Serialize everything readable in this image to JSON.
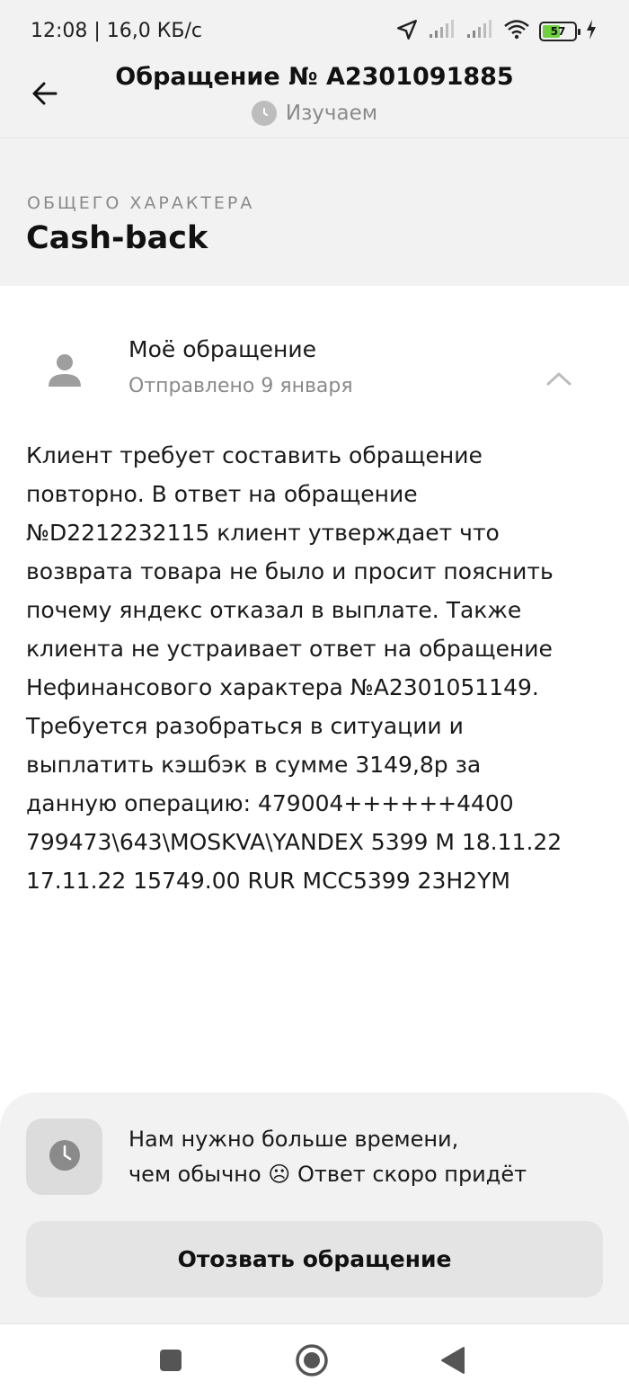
{
  "status_bar": {
    "time_speed": "12:08 | 16,0 КБ/с",
    "battery_level": "57",
    "battery_fraction": 0.57
  },
  "header": {
    "title": "Обращение № A2301091885",
    "status": "Изучаем"
  },
  "category": {
    "label": "ОБЩЕГО ХАРАКТЕРА",
    "title": "Cash-back"
  },
  "message": {
    "title": "Моё обращение",
    "date": "Отправлено 9 января",
    "body": "Клиент требует составить обращение\nповторно. В ответ на обращение\n№D2212232115 клиент утверждает что\nвозврата товара не было и просит пояснить\nпочему яндекс отказал в выплате. Также\nклиента не устраивает ответ на обращение\nНефинансового характера №A2301051149.\nТребуется разобраться в ситуации и\nвыплатить кэшбэк в сумме 3149,8р за\nданную операцию: 479004++++++4400\n799473\\643\\MOSKVA\\YANDEX 5399 M 18.11.22\n17.11.22 15749.00 RUR MCC5399 23H2YM"
  },
  "notice": {
    "line1": "Нам нужно больше времени,",
    "line2": "чем обычно ☹ Ответ скоро придёт"
  },
  "actions": {
    "withdraw_label": "Отозвать обращение"
  },
  "icons": {
    "back": "arrow-left-icon",
    "status": "clock-icon",
    "avatar": "person-icon",
    "collapse": "chevron-up-icon",
    "nav": [
      "square-icon",
      "circle-icon",
      "triangle-back-icon"
    ]
  },
  "colors": {
    "panel_bg": "#f2f2f2",
    "muted_text": "#8a8a8a",
    "battery_green": "#6dd13b"
  }
}
